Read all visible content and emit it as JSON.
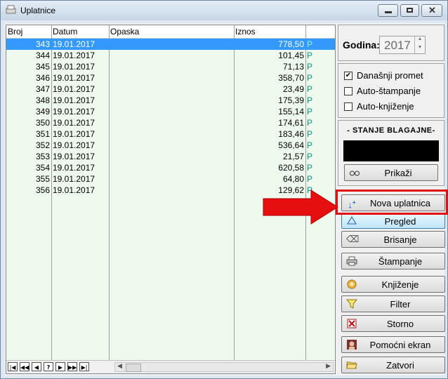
{
  "window": {
    "title": "Uplatnice"
  },
  "grid": {
    "headers": {
      "broj": "Broj",
      "datum": "Datum",
      "opaska": "Opaska",
      "iznos": "Iznos"
    },
    "rows": [
      {
        "broj": "343",
        "datum": "19.01.2017",
        "iznos": "778,50",
        "flag": "P"
      },
      {
        "broj": "344",
        "datum": "19.01.2017",
        "iznos": "101,45",
        "flag": "P"
      },
      {
        "broj": "345",
        "datum": "19.01.2017",
        "iznos": "71,13",
        "flag": "P"
      },
      {
        "broj": "346",
        "datum": "19.01.2017",
        "iznos": "358,70",
        "flag": "P"
      },
      {
        "broj": "347",
        "datum": "19.01.2017",
        "iznos": "23,49",
        "flag": "P"
      },
      {
        "broj": "348",
        "datum": "19.01.2017",
        "iznos": "175,39",
        "flag": "P"
      },
      {
        "broj": "349",
        "datum": "19.01.2017",
        "iznos": "155,14",
        "flag": "P"
      },
      {
        "broj": "350",
        "datum": "19.01.2017",
        "iznos": "174,61",
        "flag": "P"
      },
      {
        "broj": "351",
        "datum": "19.01.2017",
        "iznos": "183,46",
        "flag": "P"
      },
      {
        "broj": "352",
        "datum": "19.01.2017",
        "iznos": "536,64",
        "flag": "P"
      },
      {
        "broj": "353",
        "datum": "19.01.2017",
        "iznos": "21,57",
        "flag": "P"
      },
      {
        "broj": "354",
        "datum": "19.01.2017",
        "iznos": "620,58",
        "flag": "P"
      },
      {
        "broj": "355",
        "datum": "19.01.2017",
        "iznos": "64,80",
        "flag": "P"
      },
      {
        "broj": "356",
        "datum": "19.01.2017",
        "iznos": "129,62",
        "flag": "P"
      }
    ],
    "nav": [
      "first-icon",
      "prev-page-icon",
      "prev-icon",
      "help-icon",
      "next-icon",
      "next-page-icon",
      "last-icon"
    ]
  },
  "sidebar": {
    "godina_label": "Godina:",
    "godina_value": "2017",
    "options": [
      {
        "label": "Današnji promet",
        "checked": true
      },
      {
        "label": "Auto-štampanje",
        "checked": false
      },
      {
        "label": "Auto-knjiženje",
        "checked": false
      }
    ],
    "stanje_title": "- STANJE BLAGAJNE-",
    "prikazi": "Prikaži",
    "buttons": {
      "nova": "Nova uplatnica",
      "pregled": "Pregled",
      "brisanje": "Brisanje",
      "stampanje": "Štampanje",
      "knjizenje": "Knjiženje",
      "filter": "Filter",
      "storno": "Storno",
      "pomocni": "Pomoćni ekran",
      "zatvori": "Zatvori"
    }
  },
  "colors": {
    "selection": "#3399ff",
    "grid_bg": "#eefaee",
    "highlight": "#e01010"
  }
}
